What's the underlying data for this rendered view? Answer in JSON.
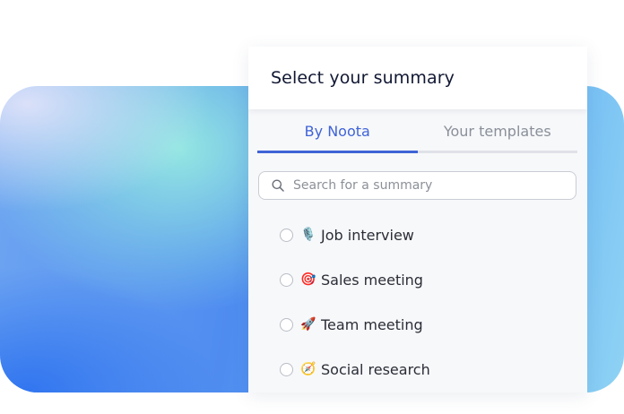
{
  "panel": {
    "title": "Select your summary"
  },
  "tabs": [
    {
      "label": "By Noota",
      "active": true
    },
    {
      "label": "Your templates",
      "active": false
    }
  ],
  "search": {
    "placeholder": "Search for a summary",
    "value": ""
  },
  "options": [
    {
      "emoji": "🎙️",
      "label": "Job interview",
      "selected": false
    },
    {
      "emoji": "🎯",
      "label": "Sales meeting",
      "selected": false
    },
    {
      "emoji": "🚀",
      "label": "Team meeting",
      "selected": false
    },
    {
      "emoji": "🧭",
      "label": "Social research",
      "selected": false
    }
  ],
  "colors": {
    "accent": "#3f63d7",
    "title": "#111833",
    "muted": "#8a8f99"
  }
}
